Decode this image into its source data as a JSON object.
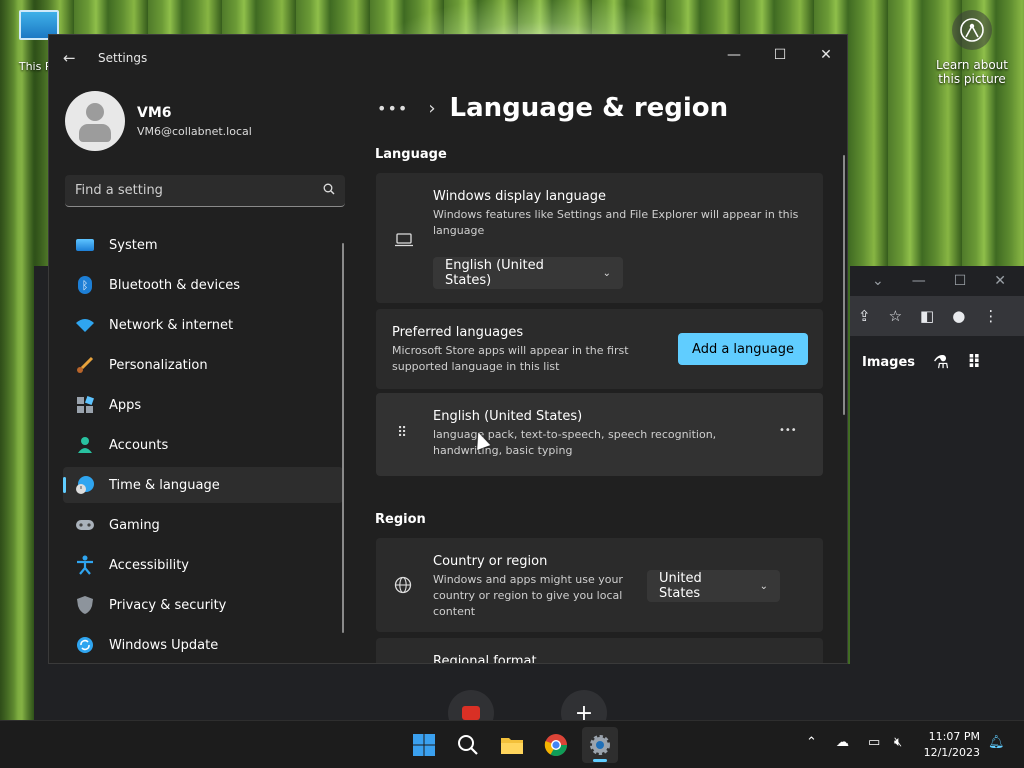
{
  "desktop": {
    "this_pc_label": "This PC",
    "learn_label_1": "Learn about",
    "learn_label_2": "this picture"
  },
  "browser": {
    "images_label": "Images"
  },
  "window": {
    "title": "Settings"
  },
  "user": {
    "name": "VM6",
    "email": "VM6@collabnet.local"
  },
  "search": {
    "placeholder": "Find a setting"
  },
  "nav": {
    "items": [
      {
        "label": "System",
        "icon": "system-icon"
      },
      {
        "label": "Bluetooth & devices",
        "icon": "bluetooth-icon"
      },
      {
        "label": "Network & internet",
        "icon": "wifi-icon"
      },
      {
        "label": "Personalization",
        "icon": "brush-icon"
      },
      {
        "label": "Apps",
        "icon": "apps-icon"
      },
      {
        "label": "Accounts",
        "icon": "accounts-icon"
      },
      {
        "label": "Time & language",
        "icon": "time-language-icon",
        "active": true
      },
      {
        "label": "Gaming",
        "icon": "gamepad-icon"
      },
      {
        "label": "Accessibility",
        "icon": "accessibility-icon"
      },
      {
        "label": "Privacy & security",
        "icon": "shield-icon"
      },
      {
        "label": "Windows Update",
        "icon": "update-icon"
      }
    ]
  },
  "page": {
    "breadcrumb_more": "•••",
    "title": "Language & region",
    "language_header": "Language",
    "display_language": {
      "title": "Windows display language",
      "desc": "Windows features like Settings and File Explorer will appear in this language",
      "value": "English (United States)"
    },
    "preferred": {
      "title": "Preferred languages",
      "desc": "Microsoft Store apps will appear in the first supported language in this list",
      "button": "Add a language"
    },
    "installed_language": {
      "title": "English (United States)",
      "desc": "language pack, text-to-speech, speech recognition, handwriting, basic typing",
      "more": "•••"
    },
    "region_header": "Region",
    "country": {
      "title": "Country or region",
      "desc": "Windows and apps might use your country or region to give you local content",
      "value": "United States"
    },
    "regional_format": {
      "title": "Regional format"
    }
  },
  "taskbar": {
    "time": "11:07 PM",
    "date": "12/1/2023"
  },
  "colors": {
    "accent": "#60cdff",
    "window_bg": "#202020",
    "card_bg": "#2b2b2b"
  }
}
